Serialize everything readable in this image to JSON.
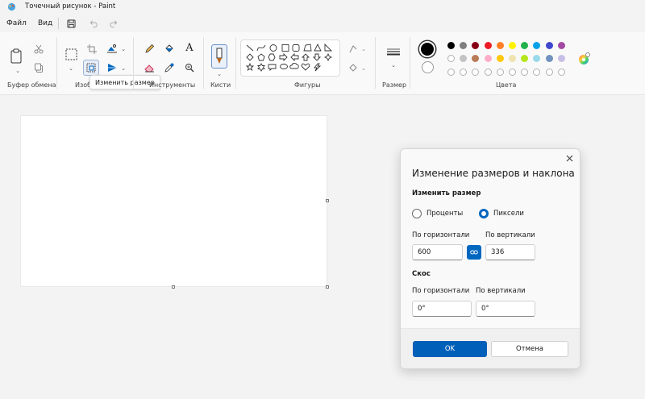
{
  "window": {
    "title": "Точечный рисунок - Paint"
  },
  "menu": {
    "file": "Файл",
    "view": "Вид"
  },
  "ribbon": {
    "groups": {
      "clipboard": "Буфер обмена",
      "image": "Изоб",
      "tools": "Инструменты",
      "brushes": "Кисти",
      "shapes": "Фигуры",
      "size": "Размер",
      "colors": "Цвета"
    },
    "tooltip": "Изменить размер"
  },
  "palette": {
    "primary": "#000000",
    "secondary": "#ffffff",
    "row1": [
      "#000000",
      "#7f7f7f",
      "#880015",
      "#ed1c24",
      "#ff7f27",
      "#fff200",
      "#22b14c",
      "#00a2e8",
      "#3f48cc",
      "#a349a4"
    ],
    "row2": [
      "#ffffff",
      "#c3c3c3",
      "#b97a57",
      "#ffaec9",
      "#ffc90e",
      "#efe4b0",
      "#b5e61d",
      "#99d9ea",
      "#7092be",
      "#c8bfe7"
    ]
  },
  "dialog": {
    "title": "Изменение размеров и наклона",
    "resize_section": "Изменить размер",
    "percent_label": "Проценты",
    "pixels_label": "Пиксели",
    "horizontal_label": "По горизонтали",
    "vertical_label": "По вертикали",
    "width_value": "600",
    "height_value": "336",
    "skew_section": "Скос",
    "skew_horizontal_label": "По горизонтали",
    "skew_vertical_label": "По вертикали",
    "skew_h_value": "0°",
    "skew_v_value": "0°",
    "ok_label": "OK",
    "cancel_label": "Отмена"
  }
}
